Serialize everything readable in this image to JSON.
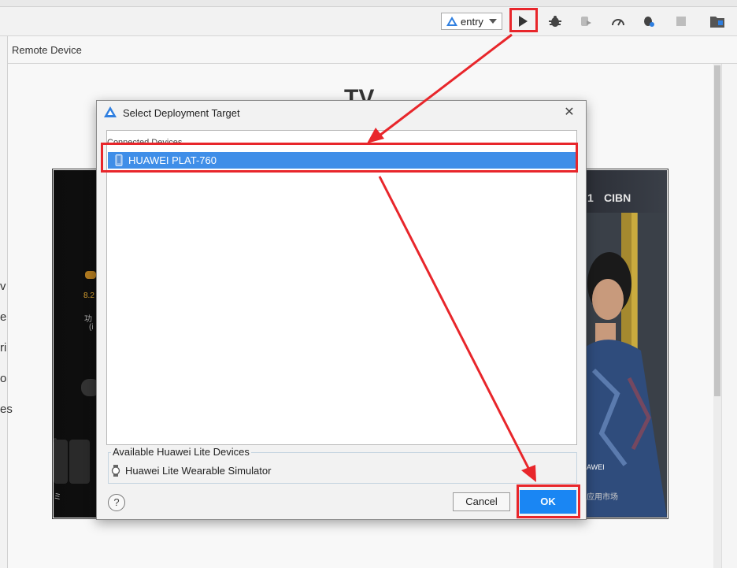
{
  "toolbar": {
    "module_select": {
      "value": "entry"
    },
    "icons": [
      "run-icon",
      "debug-icon",
      "attach-debugger-icon",
      "profiler-icon",
      "build-icon",
      "stop-icon",
      "project-structure-icon"
    ]
  },
  "panel": {
    "title": "Remote Device",
    "preview_heading": "TV",
    "side_fragments": [
      "v",
      "e",
      "ri",
      "o",
      "es"
    ]
  },
  "tv_preview": {
    "left_text_1": "8.2",
    "left_text_2": "功",
    "left_text_3": "(i",
    "channel_number": "1",
    "channel_brand": "CIBN",
    "brand_text": "AWEI",
    "market_text": "应用市场",
    "left_mark": "ミ"
  },
  "dialog": {
    "title": "Select Deployment Target",
    "close_label": "✕",
    "connected_group_label": "Connected Devices",
    "connected_devices": [
      {
        "name": "HUAWEI PLAT-760",
        "selected": true
      }
    ],
    "lite_group_label": "Available Huawei Lite Devices",
    "lite_devices": [
      {
        "name": "Huawei Lite Wearable Simulator"
      }
    ],
    "help_label": "?",
    "cancel_label": "Cancel",
    "ok_label": "OK"
  },
  "colors": {
    "selection": "#3f8ee8",
    "ok_button": "#1a86f3",
    "annotation": "#e8262b"
  }
}
